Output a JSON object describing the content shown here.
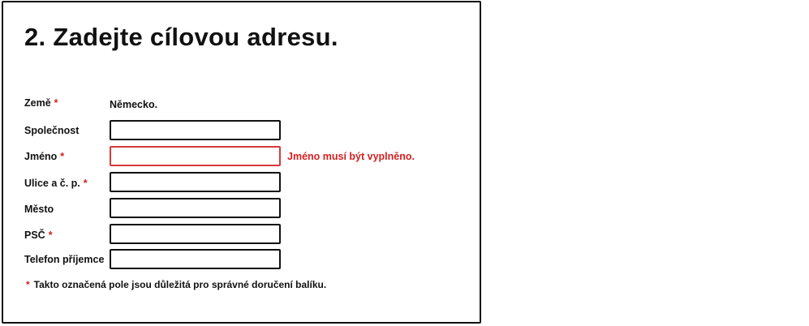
{
  "title": "2. Zadejte cílovou adresu.",
  "required_marker": "*",
  "form": {
    "country": {
      "label": "Země",
      "required": true,
      "value": "Německo."
    },
    "company": {
      "label": "Společnost",
      "required": false,
      "value": ""
    },
    "name": {
      "label": "Jméno",
      "required": true,
      "value": "",
      "error": "Jméno musí být vyplněno."
    },
    "street": {
      "label": "Ulice a č. p.",
      "required": true,
      "value": ""
    },
    "city": {
      "label": "Město",
      "required": false,
      "value": ""
    },
    "zip": {
      "label": "PSČ",
      "required": true,
      "value": ""
    },
    "phone": {
      "label": "Telefon příjemce",
      "required": false,
      "value": ""
    }
  },
  "note": "Takto označená pole jsou důležitá pro správné doručení balíku.",
  "colors": {
    "required": "#d62020",
    "error_border": "#d63a3a",
    "border": "#111111"
  }
}
